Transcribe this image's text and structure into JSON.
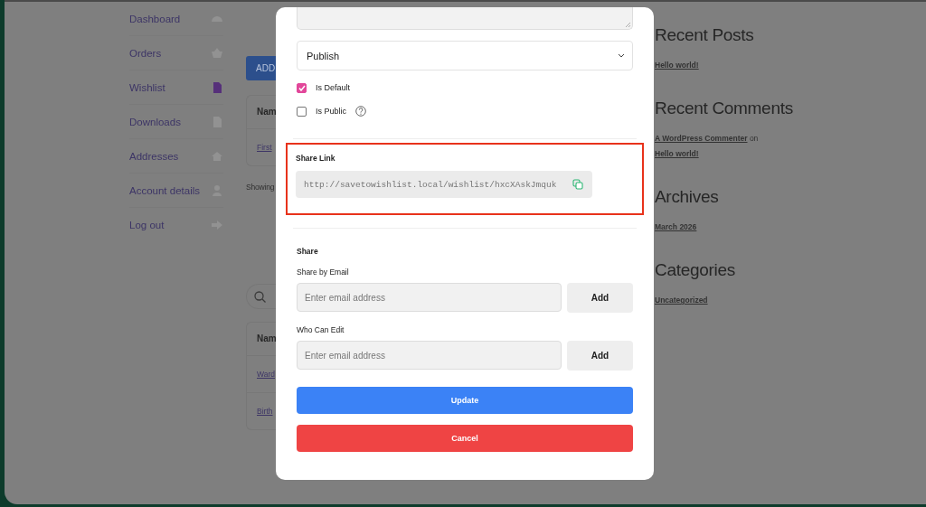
{
  "sidebar": {
    "items": [
      {
        "label": "Dashboard",
        "selected": false
      },
      {
        "label": "Orders",
        "selected": false
      },
      {
        "label": "Wishlist",
        "selected": true
      },
      {
        "label": "Downloads",
        "selected": false
      },
      {
        "label": "Addresses",
        "selected": false
      },
      {
        "label": "Account details",
        "selected": false
      },
      {
        "label": "Log out",
        "selected": false
      }
    ]
  },
  "background_page": {
    "add_button": "ADD",
    "tables": [
      {
        "header": "Nam",
        "rows": [
          "First"
        ],
        "footer": "Showing"
      },
      {
        "header": "Nam",
        "rows": [
          "Ward",
          "Birth"
        ],
        "search": true
      }
    ]
  },
  "widgets": [
    {
      "title": "Recent Posts",
      "parts": [
        {
          "kind": "link",
          "text": "Hello world!"
        }
      ]
    },
    {
      "title": "Recent Comments",
      "parts": [
        {
          "kind": "link",
          "text": "A WordPress Commenter"
        },
        {
          "kind": "text",
          "text": "on"
        },
        {
          "kind": "link",
          "text": "Hello world!"
        }
      ]
    },
    {
      "title": "Archives",
      "parts": [
        {
          "kind": "link",
          "text": "March 2026"
        }
      ]
    },
    {
      "title": "Categories",
      "parts": [
        {
          "kind": "link",
          "text": "Uncategorized"
        }
      ]
    }
  ],
  "modal": {
    "status_select": {
      "value": "Publish"
    },
    "checkboxes": [
      {
        "label": "Is Default",
        "checked": true,
        "help": false
      },
      {
        "label": "Is Public",
        "checked": false,
        "help": true
      }
    ],
    "share_link": {
      "label": "Share Link",
      "url": "http://savetowishlist.local/wishlist/hxcXAskJmquk",
      "highlighted": true
    },
    "share": {
      "title": "Share",
      "fields": [
        {
          "label": "Share by Email",
          "placeholder": "Enter email address",
          "button": "Add"
        },
        {
          "label": "Who Can Edit",
          "placeholder": "Enter email address",
          "button": "Add"
        }
      ]
    },
    "buttons": [
      {
        "label": "Update",
        "kind": "primary"
      },
      {
        "label": "Cancel",
        "kind": "danger"
      }
    ]
  }
}
